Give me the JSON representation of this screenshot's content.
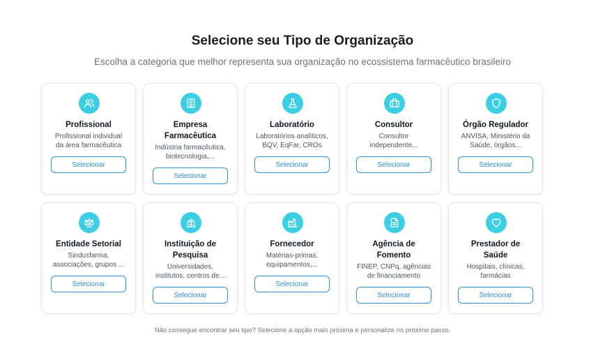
{
  "header": {
    "title": "Selecione seu Tipo de Organização",
    "subtitle": "Escolha a categoria que melhor representa sua organização no ecossistema farmacêutico brasileiro"
  },
  "colors": {
    "accent": "#3ccfe4",
    "button": "#2d8fd6"
  },
  "cards": [
    {
      "name": "Profissional",
      "desc1": "Profissional individual",
      "desc2": "da área farmacêutica",
      "button": "Selecionar",
      "icon": "users-icon"
    },
    {
      "name1": "Empresa",
      "name2": "Farmacêutica",
      "desc1": "Indústria farmacêutica,",
      "desc2": "biotecnologia,...",
      "button": "Selecionar",
      "icon": "building-icon"
    },
    {
      "name": "Laboratório",
      "desc1": "Laboratórios analíticos,",
      "desc2": "BQV, EqFar, CROs",
      "button": "Selecionar",
      "icon": "flask-icon"
    },
    {
      "name": "Consultor",
      "desc1": "Consultor",
      "desc2": "independente...",
      "button": "Selecionar",
      "icon": "briefcase-icon"
    },
    {
      "name": "Órgão Regulador",
      "desc1": "ANVISA, Ministério da",
      "desc2": "Saúde, órgãos...",
      "button": "Selecionar",
      "icon": "shield-icon"
    },
    {
      "name": "Entidade Setorial",
      "desc1": "Sindusfarma,",
      "desc2": "associações, grupos ...",
      "button": "Selecionar",
      "icon": "scale-icon"
    },
    {
      "name1": "Instituição de",
      "name2": "Pesquisa",
      "desc1": "Universidades,",
      "desc2": "institutos, centros de...",
      "button": "Selecionar",
      "icon": "school-icon"
    },
    {
      "name": "Fornecedor",
      "desc1": "Matérias-primas,",
      "desc2": "equipamentos,...",
      "button": "Selecionar",
      "icon": "factory-icon"
    },
    {
      "name1": "Agência de",
      "name2": "Fomento",
      "desc1": "FINEP, CNPq, agências",
      "desc2": "de financiamento",
      "button": "Selecionar",
      "icon": "document-icon"
    },
    {
      "name1": "Prestador de",
      "name2": "Saúde",
      "desc1": "Hospitais, clínicas,",
      "desc2": "farmácias",
      "button": "Selecionar",
      "icon": "heart-icon"
    }
  ],
  "footer": {
    "note": "Não consegue encontrar seu tipo? Selecione a opção mais próxima e personalize no próximo passo."
  }
}
